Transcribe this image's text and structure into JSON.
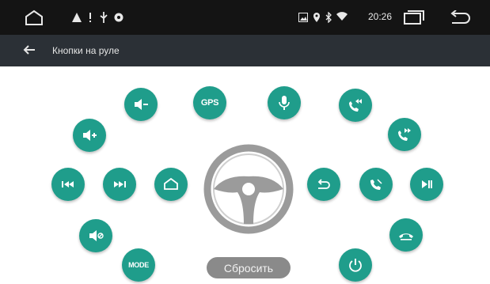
{
  "statusbar": {
    "time": "20:26",
    "left_icons": [
      "home-outline-icon",
      "warning-icon",
      "exclamation-icon",
      "usb-icon",
      "settings-icon"
    ],
    "right_icons": [
      "image-icon",
      "location-icon",
      "bluetooth-icon",
      "wifi-icon",
      "recent-apps-icon",
      "back-icon"
    ]
  },
  "titlebar": {
    "title": "Кнопки на руле",
    "back_icon": "back-arrow-icon"
  },
  "buttons": {
    "gps_label": "GPS",
    "mode_label": "MODE",
    "items": [
      {
        "name": "volume-down-button",
        "icon": "volume-down-icon"
      },
      {
        "name": "gps-button",
        "icon": "gps-text"
      },
      {
        "name": "voice-button",
        "icon": "microphone-icon"
      },
      {
        "name": "call-prev-button",
        "icon": "call-prev-icon"
      },
      {
        "name": "volume-up-button",
        "icon": "volume-up-icon"
      },
      {
        "name": "call-next-button",
        "icon": "call-next-icon"
      },
      {
        "name": "prev-track-button",
        "icon": "skip-previous-icon"
      },
      {
        "name": "next-track-button",
        "icon": "skip-next-icon"
      },
      {
        "name": "home-button",
        "icon": "home-icon"
      },
      {
        "name": "back-button",
        "icon": "back-icon"
      },
      {
        "name": "answer-call-button",
        "icon": "phone-icon"
      },
      {
        "name": "play-pause-button",
        "icon": "play-pause-icon"
      },
      {
        "name": "mute-button",
        "icon": "volume-mute-icon"
      },
      {
        "name": "hang-up-button",
        "icon": "hang-up-icon"
      },
      {
        "name": "mode-button",
        "icon": "mode-text"
      },
      {
        "name": "power-button",
        "icon": "power-icon"
      }
    ]
  },
  "reset_label": "Сбросить",
  "colors": {
    "accent": "#1f9d8b",
    "statusbar": "#141414",
    "titlebar": "#2b3036",
    "reset_button": "#8a8a8a"
  }
}
